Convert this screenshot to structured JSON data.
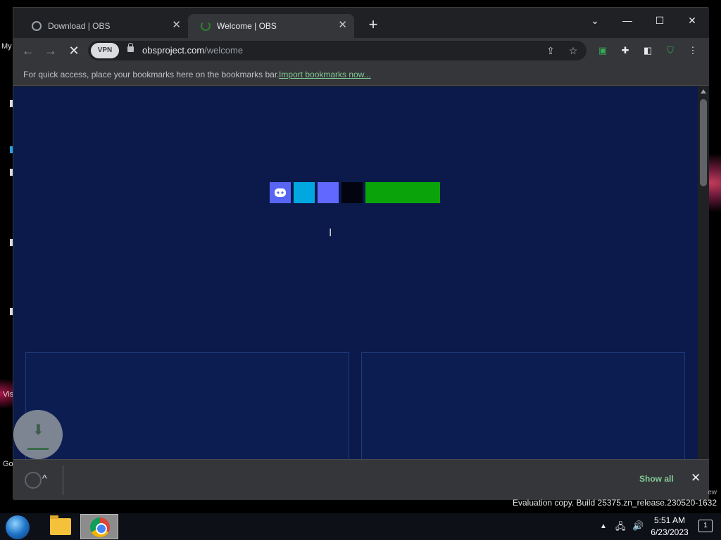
{
  "browser": {
    "tabs": [
      {
        "title": "Download | OBS",
        "active": false
      },
      {
        "title": "Welcome | OBS",
        "active": true
      }
    ],
    "address": {
      "domain": "obsproject.com",
      "path": "/welcome"
    },
    "vpn_label": "VPN",
    "bookmarks_bar": {
      "message": "For quick access, place your bookmarks here on the bookmarks bar.",
      "link": "Import bookmarks now..."
    },
    "download_bar": {
      "show_all": "Show all"
    }
  },
  "page": {
    "badges": [
      {
        "name": "discord-badge",
        "color": "#5865f2",
        "icon": "discord-icon"
      },
      {
        "name": "badge-cyan",
        "color": "#00a7e1"
      },
      {
        "name": "badge-violet",
        "color": "#6168ff"
      },
      {
        "name": "badge-black",
        "color": "#040411"
      },
      {
        "name": "badge-green",
        "color": "#0aa40a"
      }
    ],
    "background_color": "#0b1a4a"
  },
  "desktop": {
    "labels": [
      "My",
      "Vis",
      "Go"
    ],
    "watermark": "Evaluation copy. Build 25375.zn_release.230520-1632",
    "watermark_partial": "ew"
  },
  "taskbar": {
    "time": "5:51 AM",
    "date": "6/23/2023",
    "notification_count": "1"
  }
}
